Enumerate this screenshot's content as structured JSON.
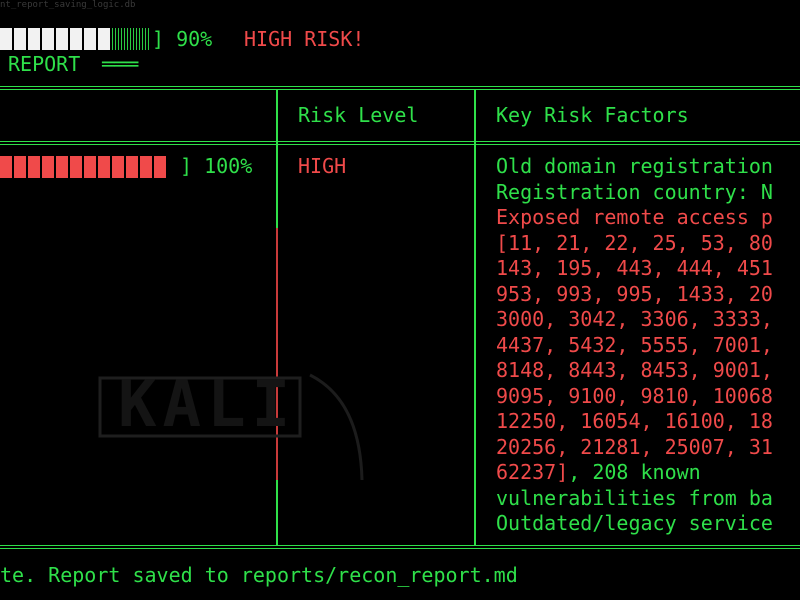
{
  "top_faint": "nt_report_saving_logic.db",
  "progress": {
    "percent_label": "] 90%",
    "fraction": 0.9,
    "risk_label": "HIGH RISK!"
  },
  "report_header": {
    "label": "REPORT",
    "rule": "═══"
  },
  "table": {
    "headers": {
      "risk_level": "Risk Level",
      "key_risk_factors": "Key Risk Factors"
    },
    "row": {
      "score_label": "] 100%",
      "score_fraction": 1.0,
      "risk_level": "HIGH",
      "factors_green": [
        "Old domain registration",
        "Registration country: N"
      ],
      "factors_red": [
        "Exposed remote access p",
        "[11, 21, 22, 25, 53, 80",
        "143, 195, 443, 444, 451",
        "953, 993, 995, 1433, 20",
        "3000, 3042, 3306, 3333,",
        "4437, 5432, 5555, 7001,",
        "8148, 8443, 8453, 9001,",
        "9095, 9100, 9810, 10068",
        "12250, 16054, 16100, 18",
        "20256, 21281, 25007, 31"
      ],
      "ports_end": "62237]",
      "factors_tail": [
        ", 208 known",
        "vulnerabilities from ba",
        "Outdated/legacy service"
      ]
    }
  },
  "footer": {
    "status": "te. Report saved to reports/recon_report.md"
  },
  "watermark": {
    "text": "KALI"
  },
  "colors": {
    "green": "#2fe04a",
    "red": "#f04a4a",
    "background": "#000000"
  },
  "icons": {
    "watermark": "kali-dragon-logo"
  }
}
